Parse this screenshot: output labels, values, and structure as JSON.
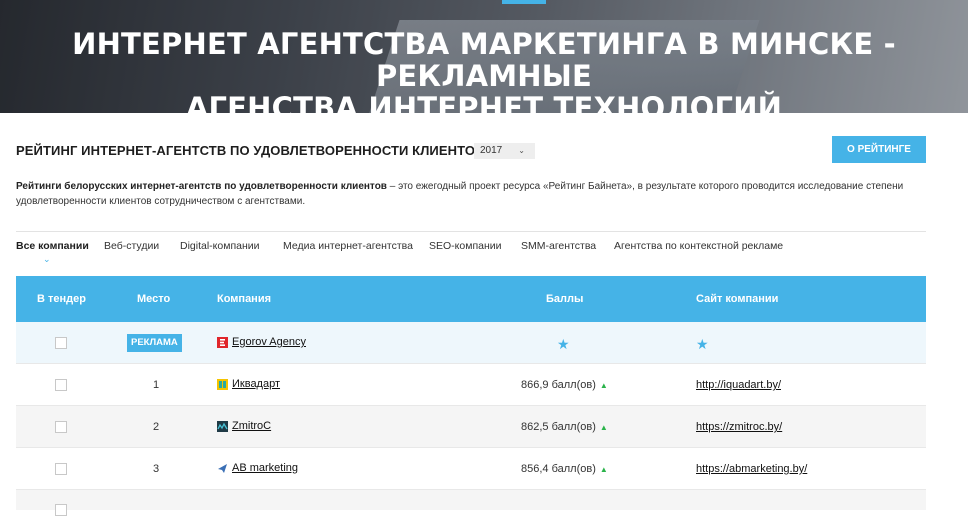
{
  "hero": {
    "title_line1": "ИНТЕРНЕТ АГЕНТСТВА МАРКЕТИНГА В МИНСКЕ - РЕКЛАМНЫЕ",
    "title_line2": "АГЕНСТВА ИНТЕРНЕТ ТЕХНОЛОГИЙ"
  },
  "rating": {
    "title": "РЕЙТИНГ ИНТЕРНЕТ-АГЕНТСТВ ПО УДОВЛЕТВОРЕННОСТИ КЛИЕНТОВ",
    "year": "2017",
    "about_button": "О РЕЙТИНГЕ",
    "desc_bold": "Рейтинги белорусских интернет-агентств по удовлетворенности клиентов",
    "desc_rest": " – это ежегодный проект ресурса «Рейтинг Байнета», в результате которого проводится исследование степени удовлетворенности клиентов сотрудничеством с агентствами."
  },
  "tabs": [
    "Все компании",
    "Веб-студии",
    "Digital-компании",
    "Медиа интернет-агентства",
    "SEO-компании",
    "SMM-агентства",
    "Агентства по контекстной рекламе"
  ],
  "table": {
    "headers": {
      "tender": "В тендер",
      "place": "Место",
      "company": "Компания",
      "score": "Баллы",
      "site": "Сайт компании"
    },
    "ad_row": {
      "badge": "РЕКЛАМА",
      "company": "Egorov Agency"
    },
    "rows": [
      {
        "place": "1",
        "company": "Иквадарт",
        "score": "866,9 балл(ов)",
        "site": "http://iquadart.by/"
      },
      {
        "place": "2",
        "company": "ZmitroC",
        "score": "862,5 балл(ов)",
        "site": "https://zmitroc.by/"
      },
      {
        "place": "3",
        "company": "AB marketing",
        "score": "856,4 балл(ов)",
        "site": "https://abmarketing.by/"
      }
    ]
  },
  "colors": {
    "accent": "#45b3e7",
    "up_arrow": "#2ab34a"
  },
  "icons": [
    "chevron-down-icon",
    "star-icon",
    "arrow-up-icon"
  ]
}
